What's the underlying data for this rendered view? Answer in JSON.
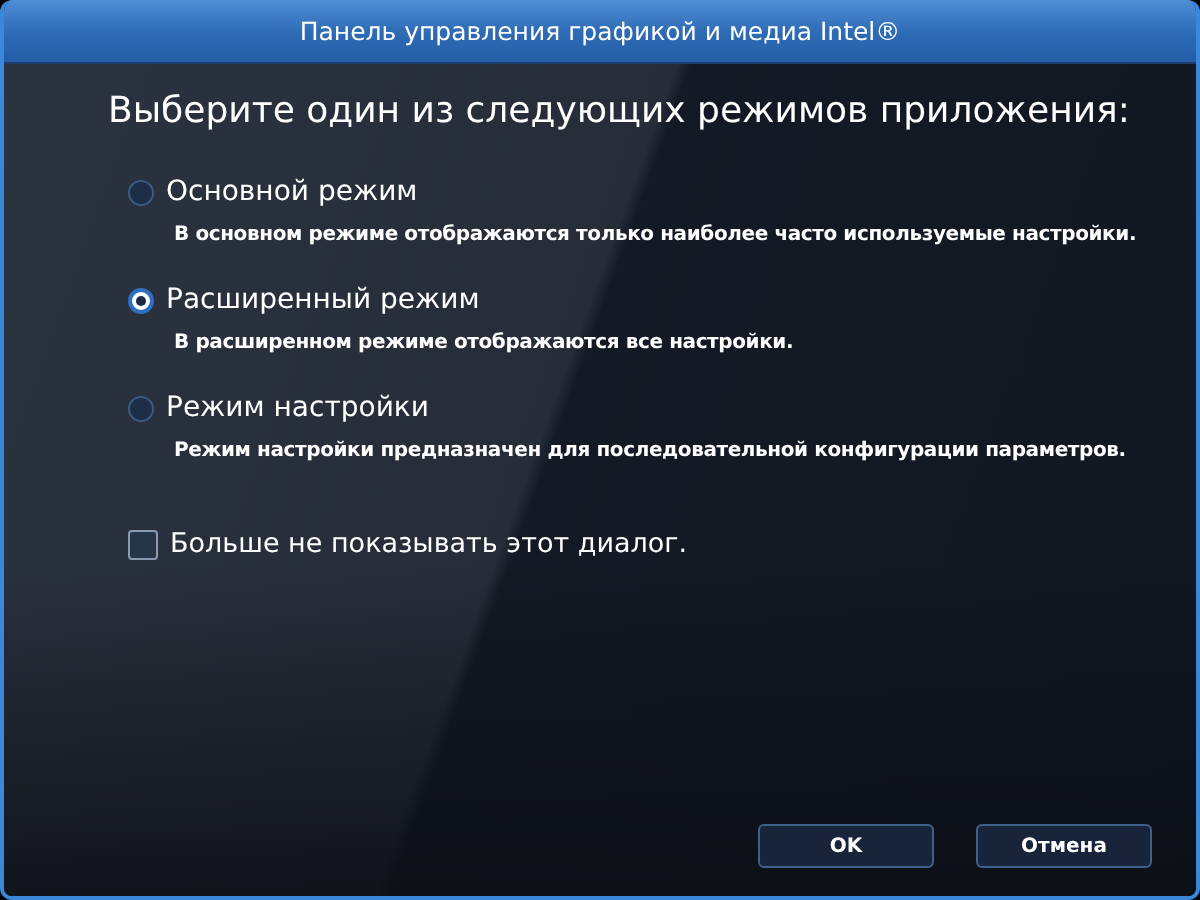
{
  "window": {
    "title": "Панель управления графикой и медиа Intel®"
  },
  "heading": "Выберите один из следующих режимов приложения:",
  "modes": [
    {
      "label": "Основной режим",
      "description": "В основном режиме отображаются только наиболее часто используемые настройки.",
      "selected": false
    },
    {
      "label": "Расширенный режим",
      "description": "В расширенном режиме отображаются все настройки.",
      "selected": true
    },
    {
      "label": "Режим настройки",
      "description": "Режим настройки предназначен для последовательной конфигурации параметров.",
      "selected": false
    }
  ],
  "dont_show": {
    "label": "Больше не показывать этот диалог.",
    "checked": false
  },
  "buttons": [
    "OK",
    "Отмена"
  ]
}
